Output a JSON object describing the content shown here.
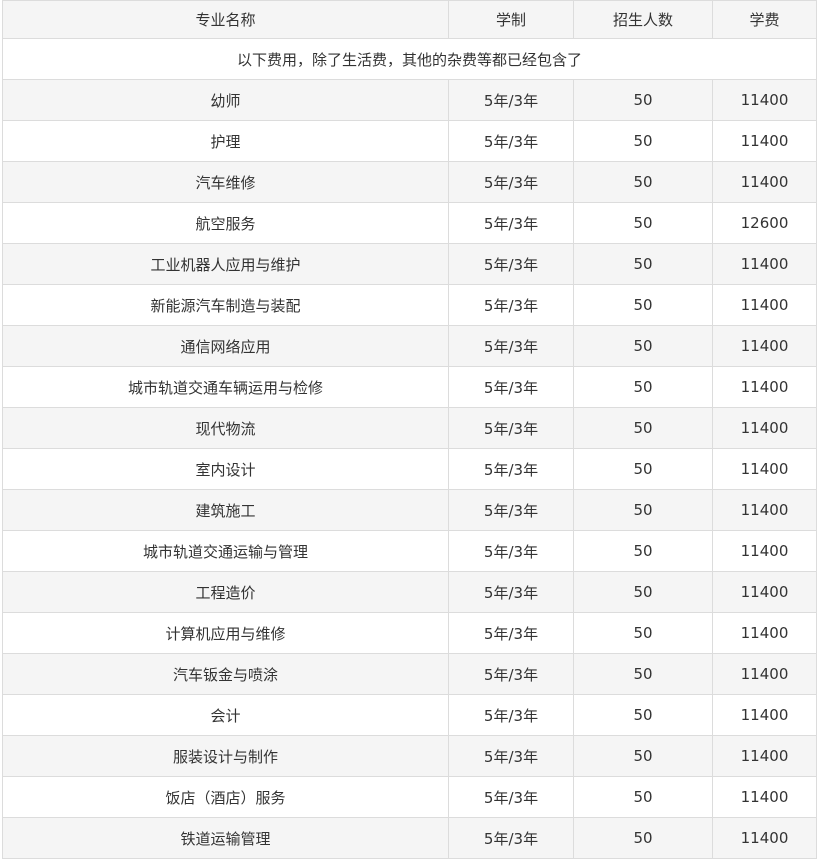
{
  "table": {
    "headers": [
      "专业名称",
      "学制",
      "招生人数",
      "学费"
    ],
    "note": "以下费用，除了生活费，其他的杂费等都已经包含了",
    "rows": [
      [
        "幼师",
        "5年/3年",
        "50",
        "11400"
      ],
      [
        "护理",
        "5年/3年",
        "50",
        "11400"
      ],
      [
        "汽车维修",
        "5年/3年",
        "50",
        "11400"
      ],
      [
        "航空服务",
        "5年/3年",
        "50",
        "12600"
      ],
      [
        "工业机器人应用与维护",
        "5年/3年",
        "50",
        "11400"
      ],
      [
        "新能源汽车制造与装配",
        "5年/3年",
        "50",
        "11400"
      ],
      [
        "通信网络应用",
        "5年/3年",
        "50",
        "11400"
      ],
      [
        "城市轨道交通车辆运用与检修",
        "5年/3年",
        "50",
        "11400"
      ],
      [
        "现代物流",
        "5年/3年",
        "50",
        "11400"
      ],
      [
        "室内设计",
        "5年/3年",
        "50",
        "11400"
      ],
      [
        "建筑施工",
        "5年/3年",
        "50",
        "11400"
      ],
      [
        "城市轨道交通运输与管理",
        "5年/3年",
        "50",
        "11400"
      ],
      [
        "工程造价",
        "5年/3年",
        "50",
        "11400"
      ],
      [
        "计算机应用与维修",
        "5年/3年",
        "50",
        "11400"
      ],
      [
        "汽车钣金与喷涂",
        "5年/3年",
        "50",
        "11400"
      ],
      [
        "会计",
        "5年/3年",
        "50",
        "11400"
      ],
      [
        "服装设计与制作",
        "5年/3年",
        "50",
        "11400"
      ],
      [
        "饭店（酒店）服务",
        "5年/3年",
        "50",
        "11400"
      ],
      [
        "铁道运输管理",
        "5年/3年",
        "50",
        "11400"
      ]
    ]
  }
}
